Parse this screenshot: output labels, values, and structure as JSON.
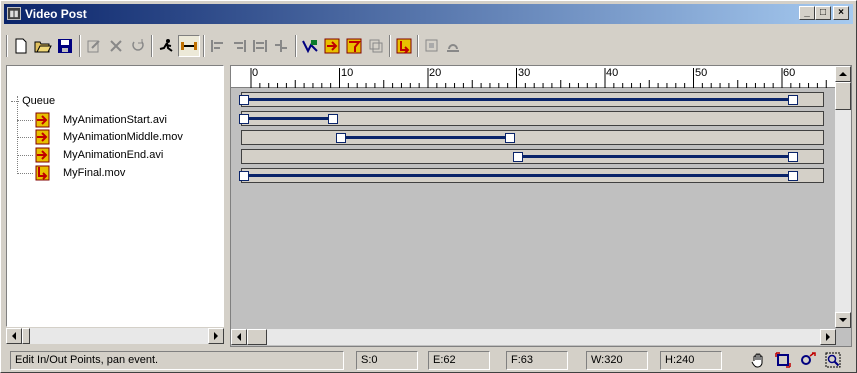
{
  "window": {
    "title": "Video Post",
    "icon": "video-post-app-icon",
    "controls": {
      "minimize": "_",
      "maximize": "□",
      "close": "×"
    }
  },
  "toolbar": {
    "items": [
      {
        "name": "new-sequence-icon"
      },
      {
        "name": "open-sequence-icon"
      },
      {
        "name": "save-sequence-icon"
      },
      {
        "name": "edit-current-event-icon"
      },
      {
        "name": "delete-current-event-icon"
      },
      {
        "name": "swap-events-icon"
      },
      {
        "name": "execute-sequence-icon"
      },
      {
        "name": "edit-range-bar-icon",
        "active": true
      },
      {
        "name": "align-selected-left-icon"
      },
      {
        "name": "align-selected-right-icon"
      },
      {
        "name": "make-selected-same-size-icon"
      },
      {
        "name": "abut-selected-icon"
      },
      {
        "name": "add-scene-event-icon"
      },
      {
        "name": "add-image-input-event-icon"
      },
      {
        "name": "add-image-filter-event-icon"
      },
      {
        "name": "add-image-layer-event-icon"
      },
      {
        "name": "add-image-output-event-icon"
      },
      {
        "name": "add-external-event-icon"
      },
      {
        "name": "add-loop-event-icon"
      }
    ]
  },
  "tree": {
    "root": "Queue",
    "items": [
      {
        "label": "MyAnimationStart.avi",
        "icon": "image-input-event-icon"
      },
      {
        "label": "MyAnimationMiddle.mov",
        "icon": "image-input-event-icon"
      },
      {
        "label": "MyAnimationEnd.avi",
        "icon": "image-input-event-icon"
      },
      {
        "label": "MyFinal.mov",
        "icon": "image-output-event-icon"
      }
    ]
  },
  "ruler": {
    "labels": [
      "0",
      "10",
      "20",
      "30",
      "40",
      "50",
      "60"
    ]
  },
  "tracks": [
    {
      "label": "Queue",
      "start": 0,
      "end": 62
    },
    {
      "label": "MyAnimationStart.avi",
      "start": 0,
      "end": 10
    },
    {
      "label": "MyAnimationMiddle.mov",
      "start": 11,
      "end": 30
    },
    {
      "label": "MyAnimationEnd.avi",
      "start": 31,
      "end": 62
    },
    {
      "label": "MyFinal.mov",
      "start": 0,
      "end": 62
    }
  ],
  "status": {
    "message": "Edit In/Out Points, pan event.",
    "start": "S:0",
    "end": "E:62",
    "frames": "F:63",
    "width": "W:320",
    "height": "H:240"
  },
  "status_icons": [
    "pan-hand-icon",
    "zoom-extents-icon",
    "zoom-time-icon",
    "zoom-region-icon"
  ],
  "colors": {
    "title_start": "#0a246a",
    "title_end": "#a6caf0",
    "range_bar": "#0a246a",
    "face": "#d4d0c8",
    "track_bg": "#c0c0c0"
  }
}
